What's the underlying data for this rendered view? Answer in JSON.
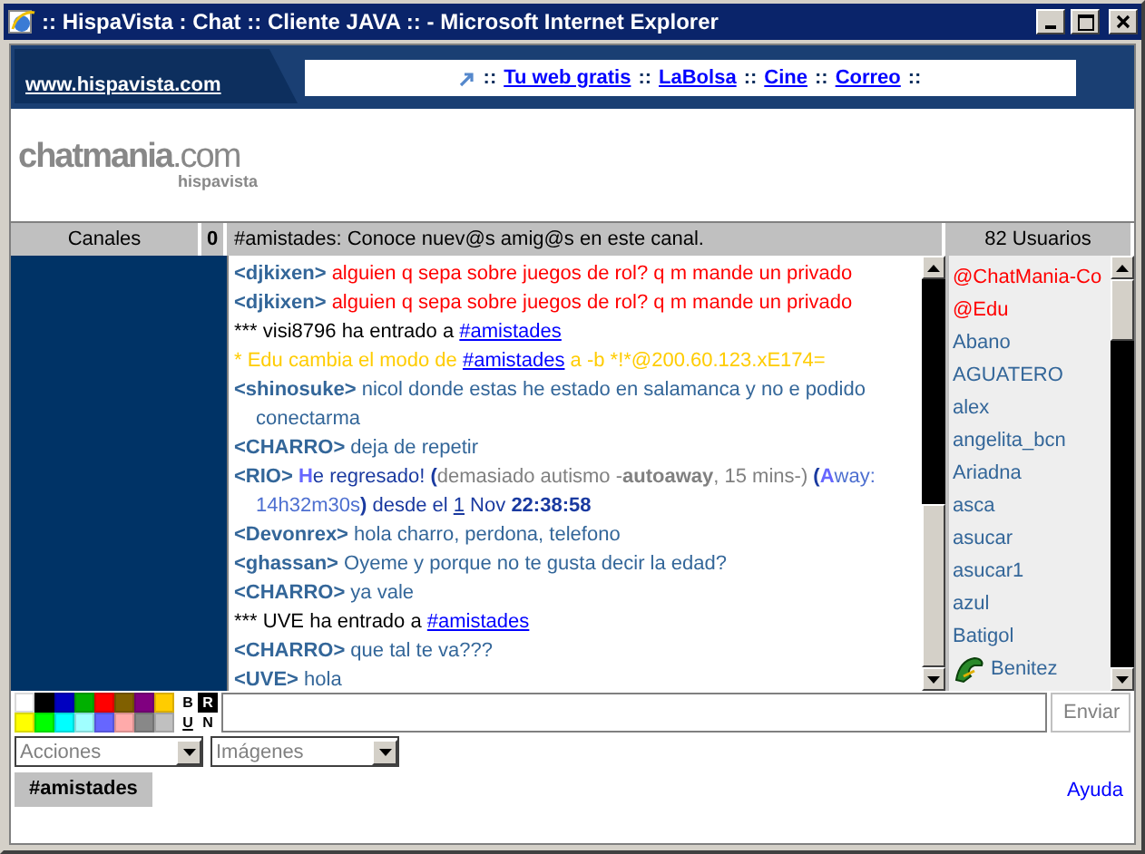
{
  "window": {
    "title": ":: HispaVista : Chat :: Cliente JAVA :: - Microsoft Internet Explorer"
  },
  "banner": {
    "site": "www.hispavista.com",
    "links": [
      {
        "text": "::",
        "kind": "sep"
      },
      {
        "text": "Tu web gratis",
        "kind": "link"
      },
      {
        "text": "::",
        "kind": "sep"
      },
      {
        "text": "LaBolsa",
        "kind": "link"
      },
      {
        "text": "::",
        "kind": "sep"
      },
      {
        "text": "Cine",
        "kind": "link"
      },
      {
        "text": "::",
        "kind": "sep"
      },
      {
        "text": "Correo",
        "kind": "link"
      },
      {
        "text": "::",
        "kind": "sep"
      }
    ]
  },
  "logo": {
    "name": "chatmania",
    "domain": ".com",
    "sub": "hispavista"
  },
  "header": {
    "channels": "Canales",
    "count": "0",
    "topic": "#amistades: Conoce nuev@s amig@s en este canal.",
    "users": "82 Usuarios"
  },
  "messages": [
    [
      {
        "text": "<djkixen> ",
        "kind": "nick"
      },
      {
        "text": " alguien q sepa sobre juegos de rol? q m mande un privado",
        "kind": "red"
      }
    ],
    [
      {
        "text": "<djkixen> ",
        "kind": "nick"
      },
      {
        "text": " alguien q sepa sobre juegos de rol? q m mande un privado",
        "kind": "red"
      }
    ],
    [
      {
        "text": "*** visi8796 ha entrado a ",
        "kind": "black"
      },
      {
        "text": "#amistades",
        "kind": "link"
      }
    ],
    [
      {
        "text": "* Edu cambia el modo de ",
        "kind": "yellow"
      },
      {
        "text": "#amistades",
        "kind": "link"
      },
      {
        "text": " a -b *!*@200.60.123.xE174=",
        "kind": "yellow"
      }
    ],
    [
      {
        "text": "<shinosuke>",
        "kind": "nick"
      },
      {
        "text": " nicol donde estas he estado en salamanca y no e podido conectarma",
        "kind": "plain"
      }
    ],
    [
      {
        "text": "<CHARRO>",
        "kind": "nick"
      },
      {
        "text": " deja de repetir",
        "kind": "plain"
      }
    ],
    [
      {
        "text": "<RIO>",
        "kind": "nick"
      },
      {
        "text": " H",
        "kind": "accent"
      },
      {
        "text": "e regresado! ",
        "kind": "blue"
      },
      {
        "text": "(",
        "kind": "bluebold"
      },
      {
        "text": "demasiado autismo -",
        "kind": "gray"
      },
      {
        "text": "autoaway",
        "kind": "graybold"
      },
      {
        "text": ", 15 mins-) ",
        "kind": "gray"
      },
      {
        "text": "(",
        "kind": "bluebold"
      },
      {
        "text": "A",
        "kind": "accent"
      },
      {
        "text": "way: 14h32m30s",
        "kind": "lightblue"
      },
      {
        "text": ")",
        "kind": "bluebold"
      },
      {
        "text": " desde el ",
        "kind": "blue"
      },
      {
        "text": "1",
        "kind": "underline"
      },
      {
        "text": " Nov ",
        "kind": "blue"
      },
      {
        "text": "22:38:58",
        "kind": "bluebold"
      }
    ],
    [
      {
        "text": "<Devonrex>",
        "kind": "nick"
      },
      {
        "text": " hola charro, perdona, telefono",
        "kind": "plain"
      }
    ],
    [
      {
        "text": "<ghassan>",
        "kind": "nick"
      },
      {
        "text": " Oyeme y porque no te gusta decir la edad?",
        "kind": "plain"
      }
    ],
    [
      {
        "text": "<CHARRO>",
        "kind": "nick"
      },
      {
        "text": " ya vale",
        "kind": "plain"
      }
    ],
    [
      {
        "text": "*** UVE ha entrado a ",
        "kind": "black"
      },
      {
        "text": "#amistades",
        "kind": "link"
      }
    ],
    [
      {
        "text": "<CHARRO>",
        "kind": "nick"
      },
      {
        "text": " que tal te va???",
        "kind": "plain"
      }
    ],
    [
      {
        "text": "<UVE>",
        "kind": "nick"
      },
      {
        "text": " hola",
        "kind": "plain"
      }
    ]
  ],
  "users": [
    {
      "name": "@ChatMania-Co",
      "color": "#ff0000",
      "kind": "plain"
    },
    {
      "name": "@Edu",
      "color": "#ff0000",
      "kind": "plain"
    },
    {
      "name": "Abano",
      "color": "#336699",
      "kind": "plain"
    },
    {
      "name": "AGUATERO",
      "color": "#336699",
      "kind": "plain"
    },
    {
      "name": "alex",
      "color": "#336699",
      "kind": "plain"
    },
    {
      "name": "angelita_bcn",
      "color": "#336699",
      "kind": "plain"
    },
    {
      "name": "Ariadna",
      "color": "#336699",
      "kind": "plain"
    },
    {
      "name": "asca",
      "color": "#336699",
      "kind": "plain"
    },
    {
      "name": "asucar",
      "color": "#336699",
      "kind": "plain"
    },
    {
      "name": "asucar1",
      "color": "#336699",
      "kind": "plain"
    },
    {
      "name": "azul",
      "color": "#336699",
      "kind": "plain"
    },
    {
      "name": "Batigol",
      "color": "#336699",
      "kind": "plain"
    },
    {
      "name": "Benitez",
      "color": "#336699",
      "kind": "icon"
    }
  ],
  "palette": [
    {
      "color": "#ffffff"
    },
    {
      "color": "#000000"
    },
    {
      "color": "#0000c0"
    },
    {
      "color": "#00b000"
    },
    {
      "color": "#ff0000"
    },
    {
      "color": "#806000"
    },
    {
      "color": "#800080"
    },
    {
      "color": "#ffcc00"
    },
    {
      "color": "#ffff00"
    },
    {
      "color": "#00ff00"
    },
    {
      "color": "#00ffff"
    },
    {
      "color": "#a0ffff"
    },
    {
      "color": "#6666ff"
    },
    {
      "color": "#ffaaaa"
    },
    {
      "color": "#888888"
    },
    {
      "color": "#c0c0c0"
    }
  ],
  "format_buttons": [
    {
      "label": "B",
      "kind": "bold"
    },
    {
      "label": "R",
      "kind": "reverse"
    },
    {
      "label": "U",
      "kind": "underline"
    },
    {
      "label": "N",
      "kind": "normal"
    }
  ],
  "send": "Enviar",
  "selects": [
    {
      "placeholder": "Acciones"
    },
    {
      "placeholder": "Imágenes"
    }
  ],
  "tabs": [
    {
      "label": "#amistades",
      "selected": true
    }
  ],
  "help": "Ayuda"
}
